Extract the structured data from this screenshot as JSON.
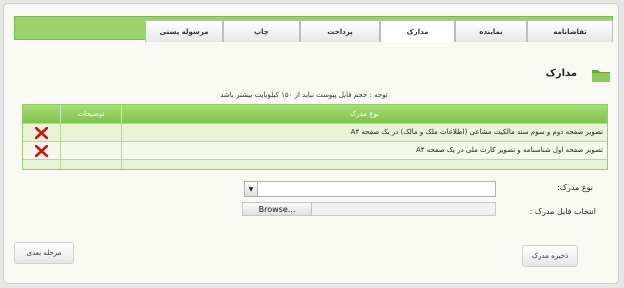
{
  "tabs": [
    {
      "label": "تقاضانامه"
    },
    {
      "label": "نماینده"
    },
    {
      "label": "مدارک",
      "active": true
    },
    {
      "label": "پرداخت"
    },
    {
      "label": "چاپ"
    },
    {
      "label": "مرسوله پستی"
    }
  ],
  "section": {
    "title": "مدارک",
    "icon": "folder-icon"
  },
  "notice": "توجه : حجم فایل پیوست نباید از ۱۵۰ کیلوبایت بیشتر باشد",
  "table": {
    "headers": {
      "doc_type": "نوع مدرک",
      "description": "توضیحات",
      "delete": ""
    },
    "rows": [
      {
        "doc_type": "تصویر صفحه دوم و سوم سند مالکیت مشاعی (اطلاعات ملک و مالک) در یک صفحه A۴",
        "description": "",
        "delete_icon": "red-x-icon"
      },
      {
        "doc_type": "تصویر صفحه اول شناسنامه و تصویر کارت ملی در یک صفحه A۴",
        "description": "",
        "delete_icon": "red-x-icon"
      }
    ]
  },
  "form": {
    "doc_type_label": "نوع مدرک:",
    "doc_type_value": "",
    "file_label": "انتخاب فایل مدرک :",
    "browse_label": "Browse..."
  },
  "buttons": {
    "save": "ذخیره مدرک",
    "next": "مرحله بعدی"
  },
  "colors": {
    "accent": "#8cc95c",
    "delete": "#cc1111"
  }
}
